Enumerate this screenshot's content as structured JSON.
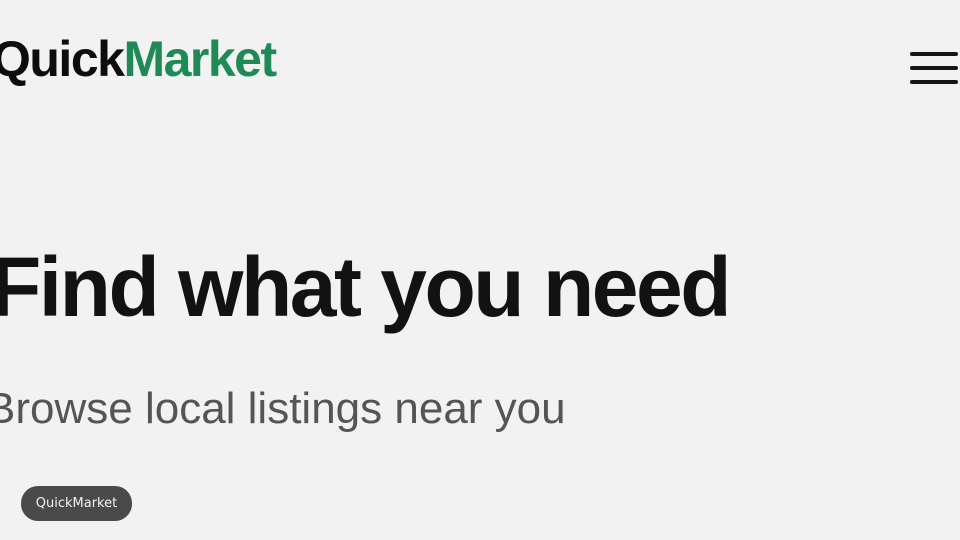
{
  "header": {
    "logo": {
      "part1": "Quick",
      "part2": "Market",
      "accent_color": "#1f8a55"
    },
    "menu_icon": "hamburger-menu-icon"
  },
  "hero": {
    "title": "Find what you need",
    "subtitle": "Browse local listings near you"
  },
  "toast": {
    "label": "QuickMarket"
  }
}
